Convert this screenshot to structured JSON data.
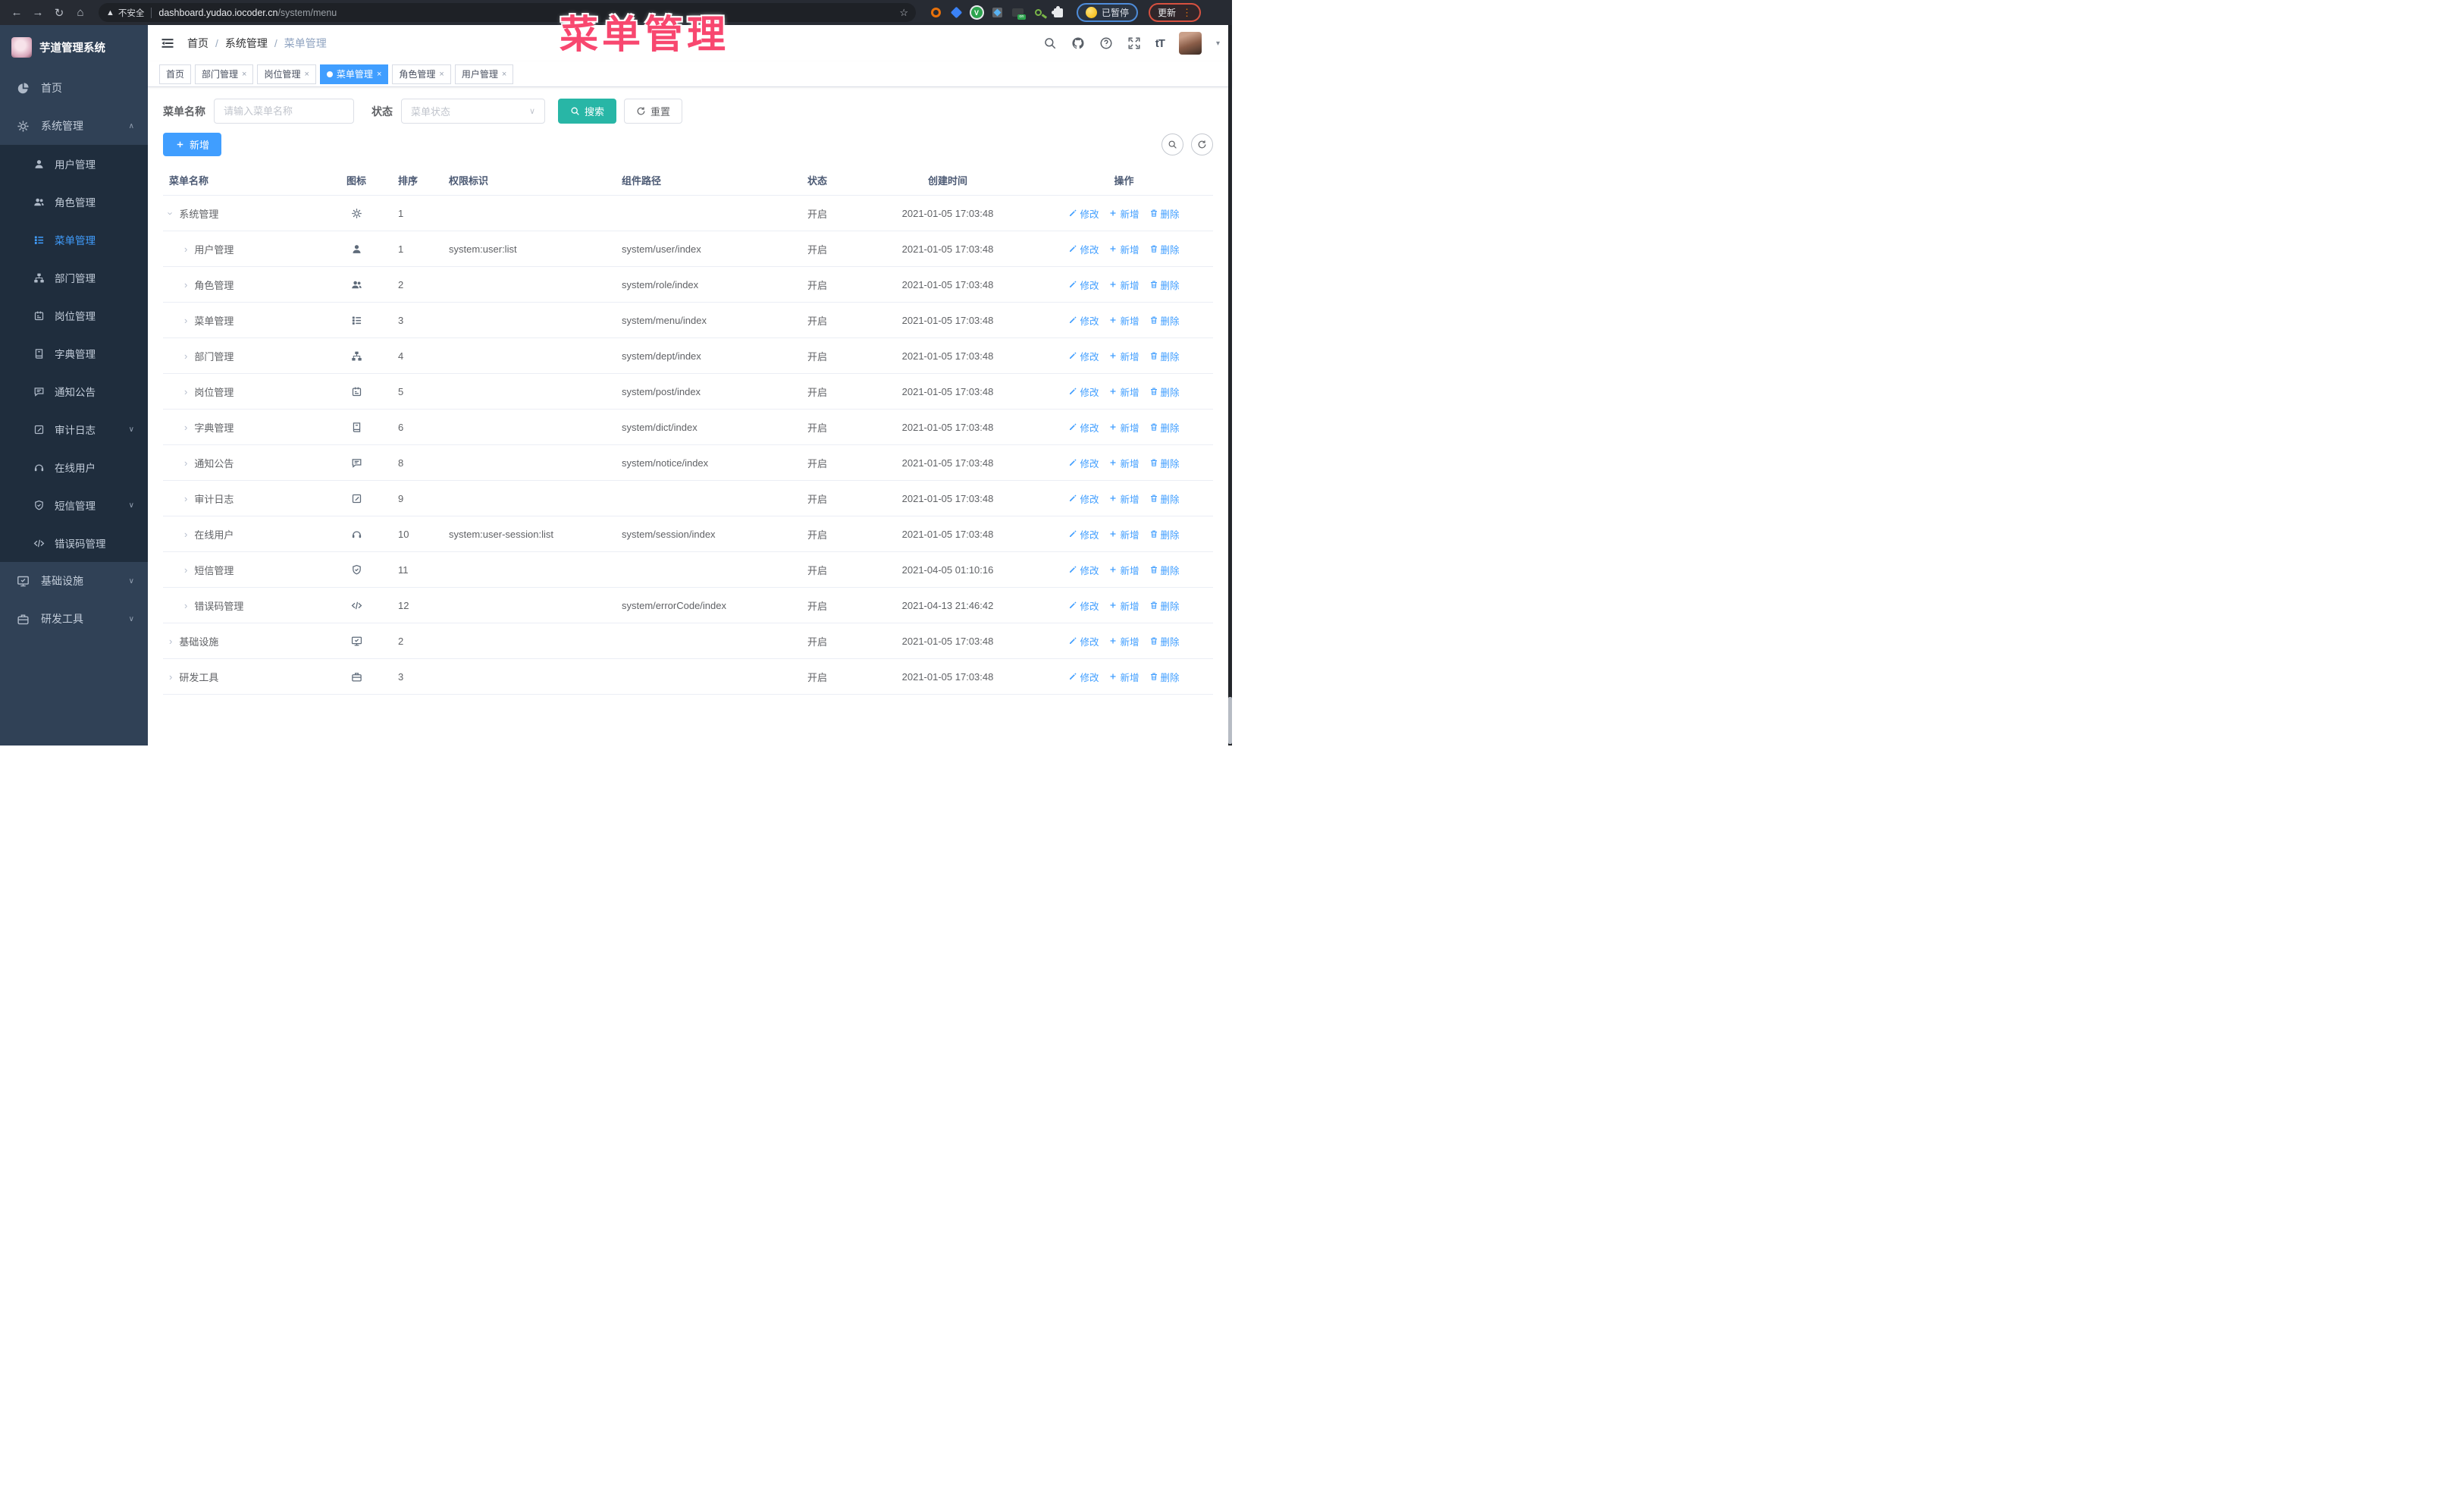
{
  "browser": {
    "insecure_label": "不安全",
    "url_host": "dashboard.yudao.iocoder.cn",
    "url_path": "/system/menu",
    "paused_label": "已暂停",
    "update_label": "更新"
  },
  "overlay": {
    "text": "菜单管理",
    "color": "#f8476f"
  },
  "sidebar": {
    "app_title": "芋道管理系统",
    "items": [
      {
        "label": "首页",
        "icon": "dashboard-icon"
      },
      {
        "label": "系统管理",
        "icon": "gear-icon",
        "arrow": "up",
        "expanded": true,
        "children": [
          {
            "label": "用户管理",
            "icon": "user-icon"
          },
          {
            "label": "角色管理",
            "icon": "users-icon"
          },
          {
            "label": "菜单管理",
            "icon": "menu-icon",
            "active": true
          },
          {
            "label": "部门管理",
            "icon": "tree-icon"
          },
          {
            "label": "岗位管理",
            "icon": "badge-icon"
          },
          {
            "label": "字典管理",
            "icon": "book-icon"
          },
          {
            "label": "通知公告",
            "icon": "megaphone-icon"
          },
          {
            "label": "审计日志",
            "icon": "log-icon",
            "arrow": "down"
          },
          {
            "label": "在线用户",
            "icon": "headset-icon"
          },
          {
            "label": "短信管理",
            "icon": "shield-icon",
            "arrow": "down"
          },
          {
            "label": "错误码管理",
            "icon": "code-icon"
          }
        ]
      },
      {
        "label": "基础设施",
        "icon": "monitor-icon",
        "arrow": "down"
      },
      {
        "label": "研发工具",
        "icon": "briefcase-icon",
        "arrow": "down"
      }
    ]
  },
  "header": {
    "breadcrumb": [
      "首页",
      "系统管理",
      "菜单管理"
    ]
  },
  "tabs": [
    {
      "label": "首页",
      "closable": false,
      "active": false
    },
    {
      "label": "部门管理",
      "closable": true,
      "active": false
    },
    {
      "label": "岗位管理",
      "closable": true,
      "active": false
    },
    {
      "label": "菜单管理",
      "closable": true,
      "active": true
    },
    {
      "label": "角色管理",
      "closable": true,
      "active": false
    },
    {
      "label": "用户管理",
      "closable": true,
      "active": false
    }
  ],
  "filters": {
    "name_label": "菜单名称",
    "name_placeholder": "请输入菜单名称",
    "status_label": "状态",
    "status_placeholder": "菜单状态",
    "search_label": "搜索",
    "reset_label": "重置"
  },
  "toolbar": {
    "add_label": "新增"
  },
  "table": {
    "columns": [
      "菜单名称",
      "图标",
      "排序",
      "权限标识",
      "组件路径",
      "状态",
      "创建时间",
      "操作"
    ],
    "ops": {
      "edit": "修改",
      "add": "新增",
      "delete": "删除"
    },
    "rows": [
      {
        "name": "系统管理",
        "icon": "gear-icon",
        "level": 0,
        "expanded": true,
        "sort": "1",
        "perm": "",
        "path": "",
        "status": "开启",
        "time": "2021-01-05 17:03:48"
      },
      {
        "name": "用户管理",
        "icon": "user-icon",
        "level": 1,
        "expanded": false,
        "sort": "1",
        "perm": "system:user:list",
        "path": "system/user/index",
        "status": "开启",
        "time": "2021-01-05 17:03:48"
      },
      {
        "name": "角色管理",
        "icon": "users-icon",
        "level": 1,
        "expanded": false,
        "sort": "2",
        "perm": "",
        "path": "system/role/index",
        "status": "开启",
        "time": "2021-01-05 17:03:48"
      },
      {
        "name": "菜单管理",
        "icon": "menu-icon",
        "level": 1,
        "expanded": false,
        "sort": "3",
        "perm": "",
        "path": "system/menu/index",
        "status": "开启",
        "time": "2021-01-05 17:03:48"
      },
      {
        "name": "部门管理",
        "icon": "tree-icon",
        "level": 1,
        "expanded": false,
        "sort": "4",
        "perm": "",
        "path": "system/dept/index",
        "status": "开启",
        "time": "2021-01-05 17:03:48"
      },
      {
        "name": "岗位管理",
        "icon": "badge-icon",
        "level": 1,
        "expanded": false,
        "sort": "5",
        "perm": "",
        "path": "system/post/index",
        "status": "开启",
        "time": "2021-01-05 17:03:48"
      },
      {
        "name": "字典管理",
        "icon": "book-icon",
        "level": 1,
        "expanded": false,
        "sort": "6",
        "perm": "",
        "path": "system/dict/index",
        "status": "开启",
        "time": "2021-01-05 17:03:48"
      },
      {
        "name": "通知公告",
        "icon": "megaphone-icon",
        "level": 1,
        "expanded": false,
        "sort": "8",
        "perm": "",
        "path": "system/notice/index",
        "status": "开启",
        "time": "2021-01-05 17:03:48"
      },
      {
        "name": "审计日志",
        "icon": "log-icon",
        "level": 1,
        "expanded": false,
        "sort": "9",
        "perm": "",
        "path": "",
        "status": "开启",
        "time": "2021-01-05 17:03:48"
      },
      {
        "name": "在线用户",
        "icon": "headset-icon",
        "level": 1,
        "expanded": false,
        "sort": "10",
        "perm": "system:user-session:list",
        "path": "system/session/index",
        "status": "开启",
        "time": "2021-01-05 17:03:48"
      },
      {
        "name": "短信管理",
        "icon": "shield-icon",
        "level": 1,
        "expanded": false,
        "sort": "11",
        "perm": "",
        "path": "",
        "status": "开启",
        "time": "2021-04-05 01:10:16"
      },
      {
        "name": "错误码管理",
        "icon": "code-icon",
        "level": 1,
        "expanded": false,
        "sort": "12",
        "perm": "",
        "path": "system/errorCode/index",
        "status": "开启",
        "time": "2021-04-13 21:46:42"
      },
      {
        "name": "基础设施",
        "icon": "monitor-icon",
        "level": 0,
        "expanded": false,
        "sort": "2",
        "perm": "",
        "path": "",
        "status": "开启",
        "time": "2021-01-05 17:03:48"
      },
      {
        "name": "研发工具",
        "icon": "briefcase-icon",
        "level": 0,
        "expanded": false,
        "sort": "3",
        "perm": "",
        "path": "",
        "status": "开启",
        "time": "2021-01-05 17:03:48"
      }
    ]
  }
}
